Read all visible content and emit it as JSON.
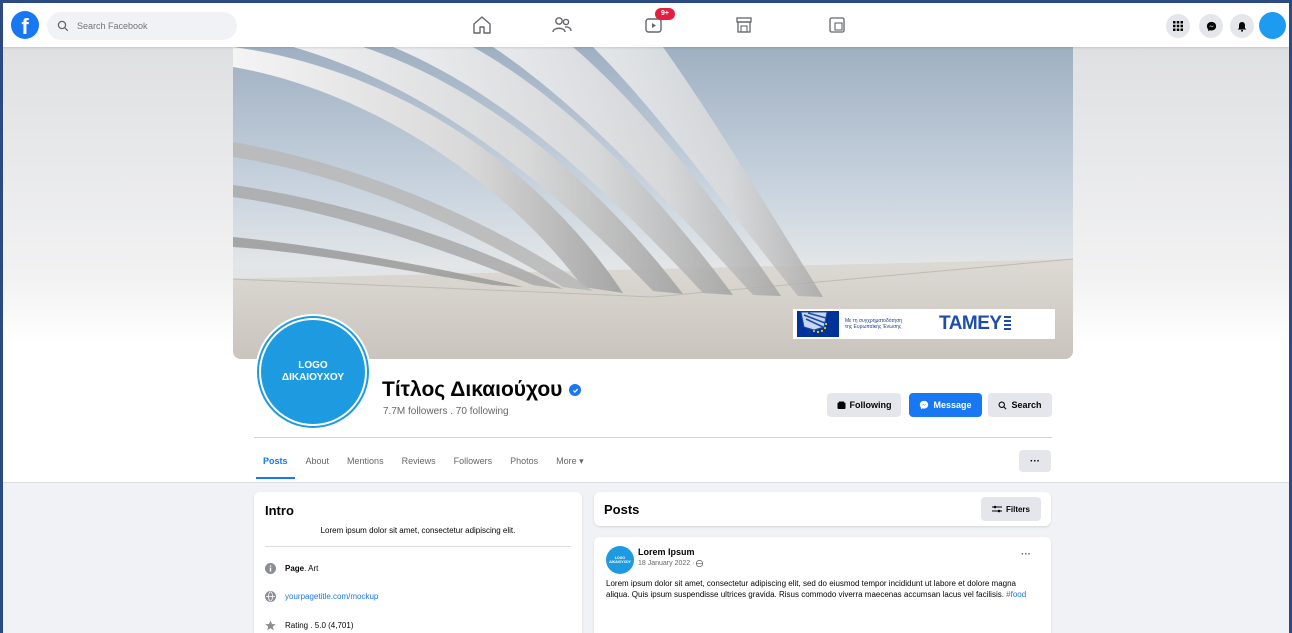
{
  "topbar": {
    "logo_letter": "f",
    "search_placeholder": "Search Facebook",
    "watch_badge": "9+"
  },
  "cover": {
    "eu_text": "Με τη συγχρηματοδότηση\nτης Ευρωπαϊκής Ένωσης",
    "tamey_label": "TAMEY"
  },
  "profile": {
    "logo_line1": "LOGO",
    "logo_line2": "ΔΙΚΑΙΟΥΧΟΥ",
    "title": "Τίτλος Δικαιούχου",
    "followers": "7.7M followers . 70 following",
    "actions": {
      "following": "Following",
      "message": "Message",
      "search": "Search"
    }
  },
  "tabs": [
    "Posts",
    "About",
    "Mentions",
    "Reviews",
    "Followers",
    "Photos",
    "More ▾"
  ],
  "more_button": "···",
  "intro": {
    "title": "Intro",
    "bio": "Lorem ipsum dolor sit amet, consectetur adipiscing elit.",
    "page_label": "Page",
    "page_category": " . Art",
    "website": "yourpagetitle.com/mockup",
    "rating": "Rating . 5.0 (4,701)"
  },
  "posts": {
    "title": "Posts",
    "filters_label": "Filters",
    "item": {
      "avatar_text": "LOGO ΔΙΚΑΙΟΥΧΟΥ",
      "author": "Lorem Ipsum",
      "date": "18 January 2022 ·",
      "menu": "···",
      "text": "Lorem ipsum dolor sit amet, consectetur adipiscing elit, sed do eiusmod tempor incididunt ut labore et dolore magna aliqua. Quis ipsum suspendisse ultrices gravida. Risus commodo viverra maecenas accumsan lacus vel facilisis. ",
      "hashtag": "#food"
    }
  },
  "colors": {
    "brand": "#1877f2",
    "logo_blue": "#1e9be0",
    "badge_red": "#e41e3f",
    "frame_border": "#2b4a84"
  }
}
